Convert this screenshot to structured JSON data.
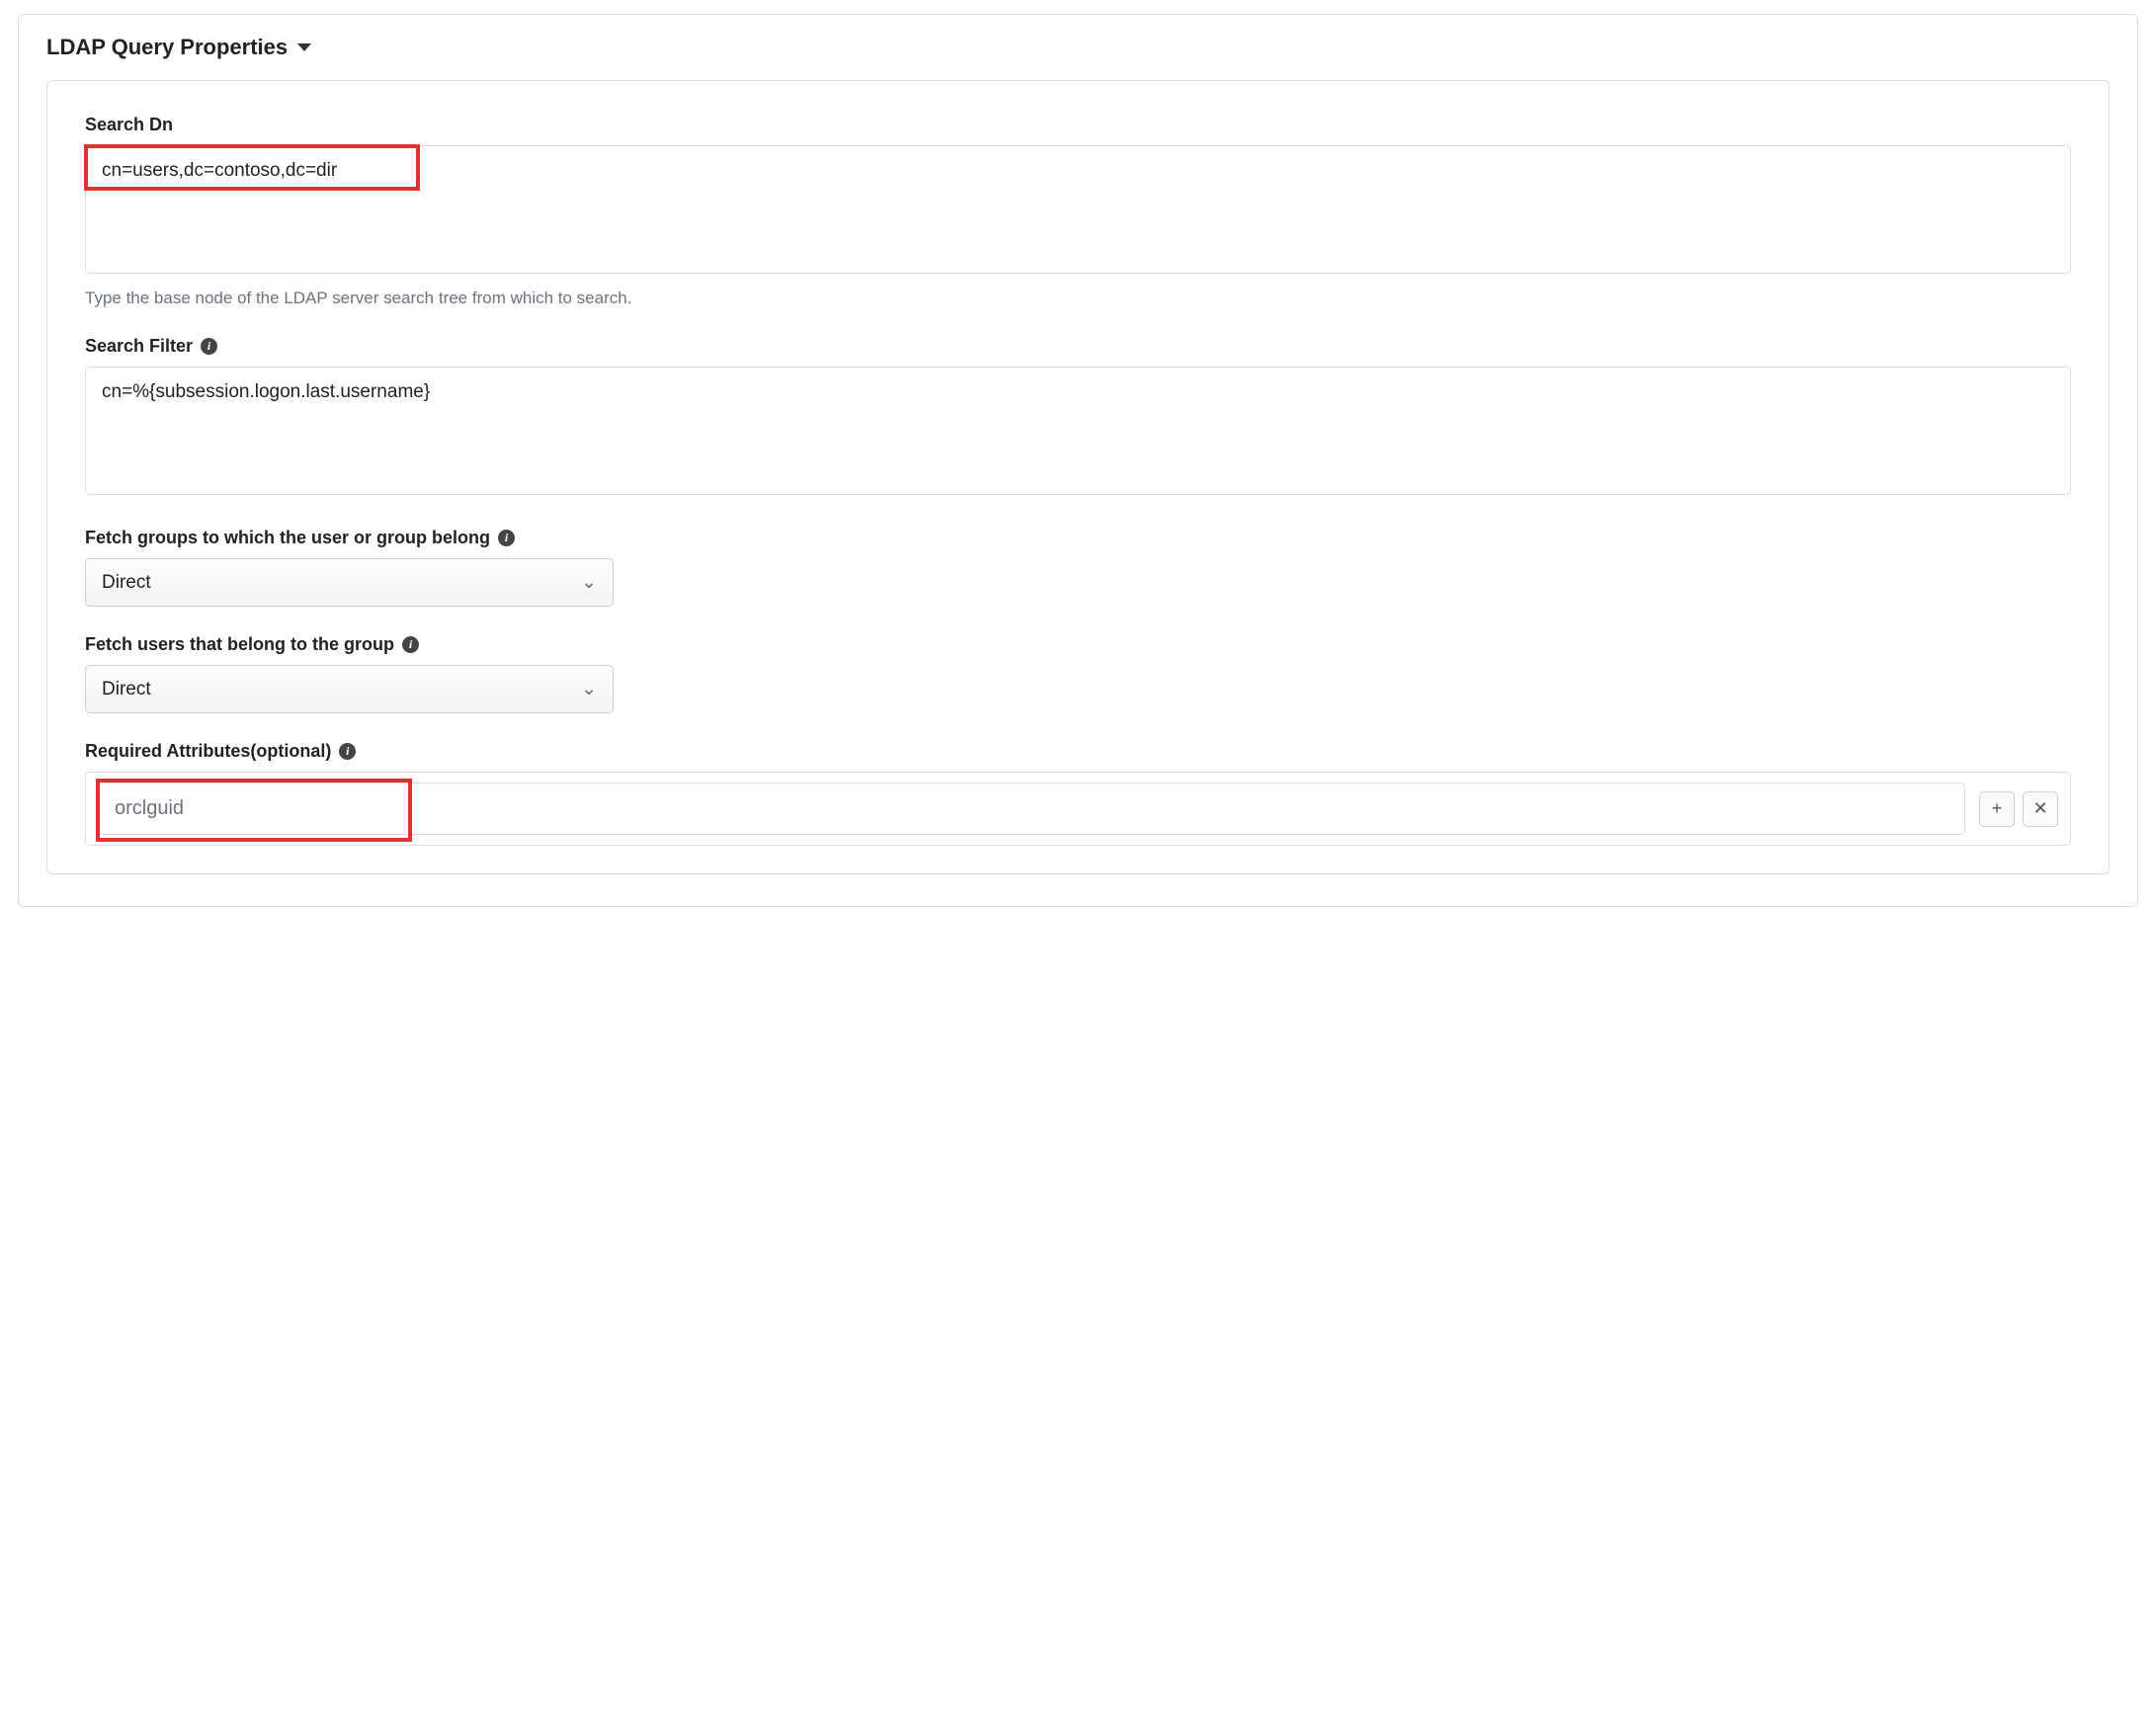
{
  "section": {
    "title": "LDAP Query Properties"
  },
  "searchDn": {
    "label": "Search Dn",
    "value": "cn=users,dc=contoso,dc=dir",
    "help": "Type the base node of the LDAP server search tree from which to search."
  },
  "searchFilter": {
    "label": "Search Filter",
    "value": "cn=%{subsession.logon.last.username}"
  },
  "fetchGroups": {
    "label": "Fetch groups to which the user or group belong",
    "value": "Direct"
  },
  "fetchUsers": {
    "label": "Fetch users that belong to the group",
    "value": "Direct"
  },
  "requiredAttrs": {
    "label": "Required Attributes(optional)",
    "value": "orclguid"
  },
  "icons": {
    "info": "i",
    "plus": "+",
    "close": "✕",
    "chevron": "⌄"
  }
}
